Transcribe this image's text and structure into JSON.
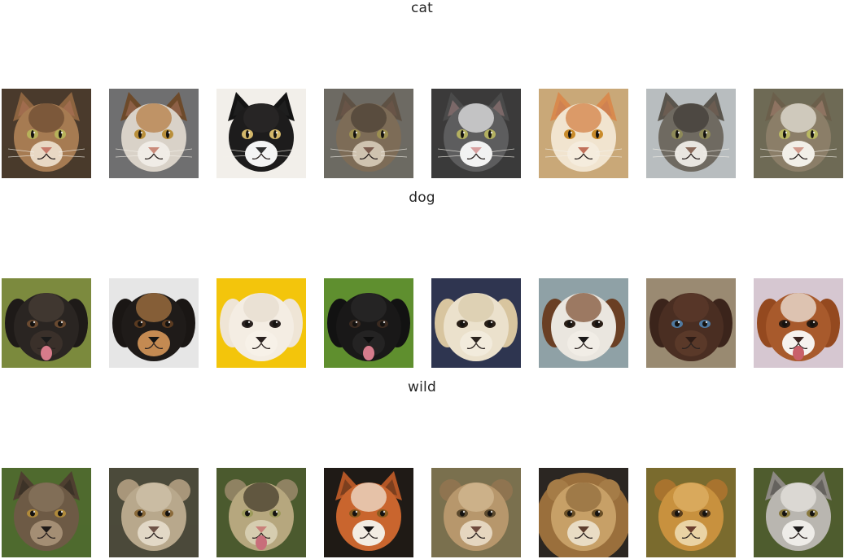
{
  "rows": [
    {
      "title": "cat",
      "tiles": [
        {
          "animal": "tabby-cat-face",
          "bg": "#4a3a2c",
          "fur": "#a67b52",
          "fur2": "#6b4a30",
          "ear": "#8d6440",
          "eye": "#b7b15a",
          "nose": "#c77a6a",
          "muzzle": "#e8d8c4"
        },
        {
          "animal": "calico-cat-face",
          "bg": "#6f6f70",
          "fur": "#d9d2c8",
          "fur2": "#b3773c",
          "ear": "#6d4a2a",
          "eye": "#b98f3a",
          "nose": "#c98a7a",
          "muzzle": "#f0ece6"
        },
        {
          "animal": "black-cat-face",
          "bg": "#f2efea",
          "fur": "#1d1c1c",
          "fur2": "#2c2a2a",
          "ear": "#141414",
          "eye": "#d4b86a",
          "nose": "#303030",
          "muzzle": "#f4f4f4"
        },
        {
          "animal": "maine-coon-cat-face",
          "bg": "#6d6a63",
          "fur": "#7d6c57",
          "fur2": "#4a3f33",
          "ear": "#5e5144",
          "eye": "#9c8f50",
          "nose": "#7b5c4e",
          "muzzle": "#cfc3b0"
        },
        {
          "animal": "grey-white-cat-face",
          "bg": "#3b3a3a",
          "fur": "#5d5d5e",
          "fur2": "#efefef",
          "ear": "#4a4a4a",
          "eye": "#b3b060",
          "nose": "#d8a0a0",
          "muzzle": "#f2f2f2"
        },
        {
          "animal": "white-orange-cat-face",
          "bg": "#c9a878",
          "fur": "#f1e4cf",
          "fur2": "#d27a3c",
          "ear": "#d88a4e",
          "eye": "#c98b2a",
          "nose": "#c0705a",
          "muzzle": "#f5ecdd"
        },
        {
          "animal": "grey-tabby-cat-face",
          "bg": "#b8bdbf",
          "fur": "#6f6a61",
          "fur2": "#3f3b35",
          "ear": "#5a554d",
          "eye": "#8e8a58",
          "nose": "#8b6a5a",
          "muzzle": "#e9e6e0"
        },
        {
          "animal": "tabby-white-cat-face",
          "bg": "#6e6a55",
          "fur": "#8b7e68",
          "fur2": "#ede9df",
          "ear": "#6b5f4b",
          "eye": "#b9b862",
          "nose": "#d19a8c",
          "muzzle": "#f2efe8"
        }
      ]
    },
    {
      "title": "dog",
      "tiles": [
        {
          "animal": "long-hair-black-dog-face",
          "bg": "#7c8a3e",
          "fur": "#2a2522",
          "fur2": "#4a3e36",
          "ear": "#1e1a18",
          "eye": "#6a4a30",
          "nose": "#1a1a1a",
          "muzzle": "#3a302a",
          "tongue": "#d77b8a"
        },
        {
          "animal": "black-tan-dog-face",
          "bg": "#e6e6e6",
          "fur": "#1f1b19",
          "fur2": "#b07a45",
          "ear": "#1a1614",
          "eye": "#5a3a20",
          "nose": "#141414",
          "muzzle": "#c48a52"
        },
        {
          "animal": "white-fluffy-dog-face",
          "bg": "#f3c50c",
          "fur": "#f4ede3",
          "fur2": "#e5dccd",
          "ear": "#efe5d6",
          "eye": "#2a2220",
          "nose": "#2a2220",
          "muzzle": "#f7f1e8"
        },
        {
          "animal": "black-lab-dog-face",
          "bg": "#5f8f2f",
          "fur": "#191818",
          "fur2": "#2b2a29",
          "ear": "#121212",
          "eye": "#3a2a20",
          "nose": "#0e0e0e",
          "muzzle": "#242323",
          "tongue": "#d67c8c"
        },
        {
          "animal": "golden-retriever-dog-face",
          "bg": "#2f3550",
          "fur": "#ebe1cc",
          "fur2": "#d9caa9",
          "ear": "#d8c59f",
          "eye": "#2a2018",
          "nose": "#2b2420",
          "muzzle": "#f2ebdc"
        },
        {
          "animal": "terrier-dog-face",
          "bg": "#8fa1a6",
          "fur": "#eae6df",
          "fur2": "#7b4a2c",
          "ear": "#6a3f24",
          "eye": "#2a1e16",
          "nose": "#1c1a1a",
          "muzzle": "#f1ede6"
        },
        {
          "animal": "chocolate-lab-dog-face",
          "bg": "#9a8a72",
          "fur": "#4a2e22",
          "fur2": "#5c3a2b",
          "ear": "#3b241b",
          "eye": "#4f79a0",
          "nose": "#2e1c16",
          "muzzle": "#5a3929"
        },
        {
          "animal": "spaniel-dog-face",
          "bg": "#d6c7d1",
          "fur": "#a85a2c",
          "fur2": "#f4efea",
          "ear": "#94491f",
          "eye": "#2a1b12",
          "nose": "#3a2420",
          "muzzle": "#f6f2ee",
          "tongue": "#c9606a"
        }
      ]
    },
    {
      "title": "wild",
      "tiles": [
        {
          "animal": "wolf-face",
          "bg": "#4f6a2e",
          "fur": "#6d5a45",
          "fur2": "#8a7660",
          "ear": "#4e3f30",
          "eye": "#b08a3a",
          "nose": "#1e1a18",
          "muzzle": "#a48e74"
        },
        {
          "animal": "lioness-face",
          "bg": "#4b4a3a",
          "fur": "#b8a88c",
          "fur2": "#d2c5ad",
          "ear": "#a8967a",
          "eye": "#8a6a3a",
          "nose": "#6f5348",
          "muzzle": "#e2d8c6"
        },
        {
          "animal": "snow-leopard-face",
          "bg": "#4b5a2e",
          "fur": "#b6a77e",
          "fur2": "#3d3526",
          "ear": "#8f8262",
          "eye": "#9c9a5a",
          "nose": "#c9807a",
          "muzzle": "#d6cdb0",
          "tongue": "#c86e7a"
        },
        {
          "animal": "red-fox-face",
          "bg": "#1f1a16",
          "fur": "#c9652e",
          "fur2": "#f2e9dd",
          "ear": "#b35626",
          "eye": "#8a5a1e",
          "nose": "#161312",
          "muzzle": "#f3ece2"
        },
        {
          "animal": "lion-cub-face",
          "bg": "#7a704e",
          "fur": "#b7976c",
          "fur2": "#d4bc96",
          "ear": "#8f7450",
          "eye": "#5c4a2e",
          "nose": "#6e4a3e",
          "muzzle": "#e5d6bf"
        },
        {
          "animal": "male-lion-face",
          "bg": "#2b2622",
          "fur": "#c7a067",
          "fur2": "#8e6a3c",
          "ear": "#a57c47",
          "eye": "#6a4f26",
          "nose": "#5e3e2e",
          "muzzle": "#e9dcc4",
          "mane": "#9a6f3c"
        },
        {
          "animal": "young-lion-face",
          "bg": "#7a6b2e",
          "fur": "#c8913e",
          "fur2": "#e0b46a",
          "ear": "#a8732e",
          "eye": "#5a3e1c",
          "nose": "#6a3e2e",
          "muzzle": "#ead3a4"
        },
        {
          "animal": "grey-wolf-face",
          "bg": "#4f5c2e",
          "fur": "#b9b6b0",
          "fur2": "#e9e7e3",
          "ear": "#8d8983",
          "eye": "#8a7a3e",
          "nose": "#1c1a1a",
          "muzzle": "#eeece8"
        }
      ]
    }
  ]
}
